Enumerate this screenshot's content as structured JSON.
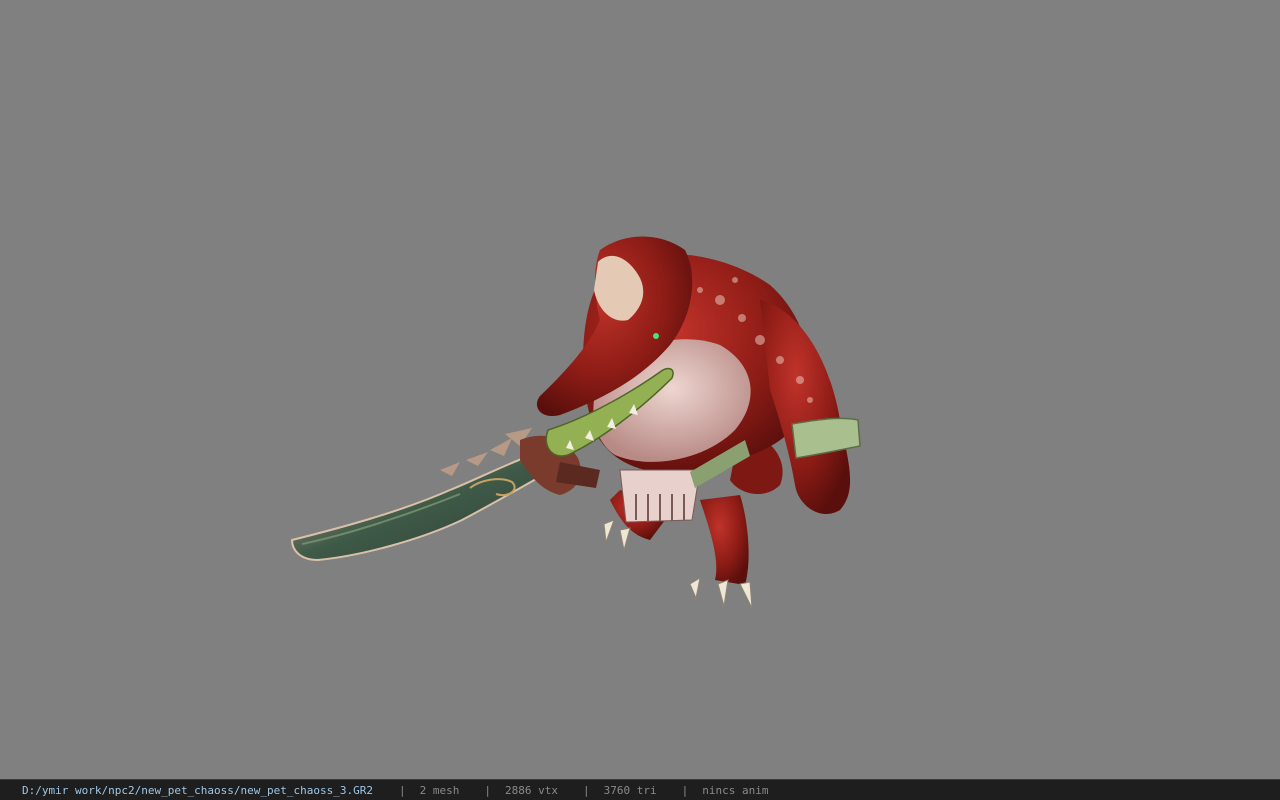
{
  "viewport": {
    "background": "#808080",
    "model_name": "new_pet_chaoss_3"
  },
  "statusbar": {
    "file_path": "D:/ymir work/npc2/new_pet_chaoss/new_pet_chaoss_3.GR2",
    "separator": "|",
    "mesh_count": "2 mesh",
    "vertex_count": "2886 vtx",
    "triangle_count": "3760 tri",
    "animation_status": "nincs anim"
  },
  "colors": {
    "statusbar_bg": "#1e1e1e",
    "path_text": "#9fc6e6",
    "info_text": "#8a8a8a"
  }
}
